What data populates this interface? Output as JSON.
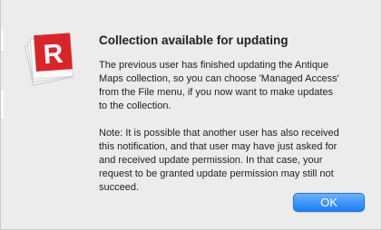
{
  "dialog": {
    "title": "Collection available for updating",
    "paragraphs": [
      "The previous user has finished updating the Antique\nMaps collection, so you can choose 'Managed Access'\nfrom the File menu, if you now want to make updates\nto the collection.",
      "Note: It is possible that another user has also received\nthis notification, and that user may have just asked for\nand received update permission. In that case, your\nrequest to be granted update permission may still not\nsucceed."
    ],
    "ok_label": "OK",
    "icon": "app-icon-red-r",
    "icon_letter": "R"
  },
  "colors": {
    "accent": "#1b7ef6",
    "icon_red": "#d9252a",
    "background": "#ececec"
  }
}
